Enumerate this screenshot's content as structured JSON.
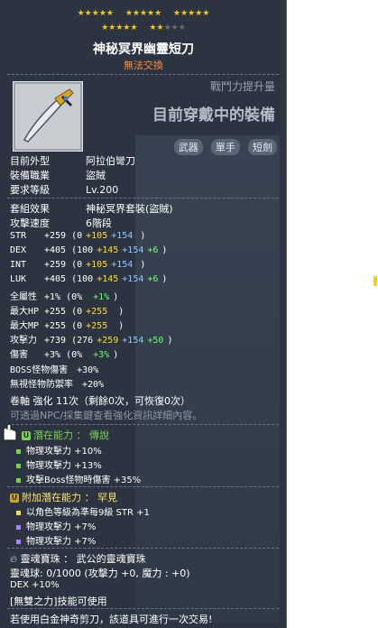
{
  "stars": {
    "row1": [
      "★★★★★",
      "★★★★★",
      "★★★★★"
    ],
    "row2_filled": [
      "★★★★★",
      "★★"
    ],
    "row2_empty": "★★★"
  },
  "item": {
    "name": "神秘冥界幽靈短刀",
    "trade": "無法交換",
    "power_up_label": "戰鬥力提升量",
    "wearing_label": "目前穿戴中的裝備"
  },
  "categories": [
    "武器",
    "單手",
    "短劍"
  ],
  "info": [
    {
      "label": "目前外型",
      "value": "阿拉伯彎刀"
    },
    {
      "label": "裝備職業",
      "value": "盜賊"
    },
    {
      "label": "要求等級",
      "value": "Lv.200"
    }
  ],
  "set": {
    "label": "套組效果",
    "value": "神秘冥界套裝(盜賊)"
  },
  "speed": {
    "label": "攻擊速度",
    "value": "6階段"
  },
  "stats": [
    {
      "name": "STR",
      "total": "+259",
      "open": "(0",
      "y": "+105",
      "b": "+154",
      "g": "",
      "close": ")"
    },
    {
      "name": "DEX",
      "total": "+405",
      "open": "(100",
      "y": "+145",
      "b": "+154",
      "g": "+6",
      "close": ")"
    },
    {
      "name": "INT",
      "total": "+259",
      "open": "(0",
      "y": "+105",
      "b": "+154",
      "g": "",
      "close": ")"
    },
    {
      "name": "LUK",
      "total": "+405",
      "open": "(100",
      "y": "+145",
      "b": "+154",
      "g": "+6",
      "close": ")"
    },
    {
      "name": "全屬性",
      "total": "+1%",
      "open": "(0%",
      "y": "",
      "b": "",
      "g": "+1%",
      "close": ")"
    },
    {
      "name": "最大HP",
      "total": "+255",
      "open": "(0",
      "y": "+255",
      "b": "",
      "g": "",
      "close": ")"
    },
    {
      "name": "最大MP",
      "total": "+255",
      "open": "(0",
      "y": "+255",
      "b": "",
      "g": "",
      "close": ")"
    },
    {
      "name": "攻擊力",
      "total": "+739",
      "open": "(276",
      "y": "+259",
      "b": "+154",
      "g": "+50",
      "close": ")"
    },
    {
      "name": "傷害",
      "total": "+3%",
      "open": "(0%",
      "y": "",
      "b": "",
      "g": "+3%",
      "close": ")"
    }
  ],
  "boss": "BOSS怪物傷害　+30%",
  "ignore": "無視怪物防禦率　+20%",
  "scroll": "卷軸 強化 11次（剩餘0次，可恢復0次）",
  "scroll_hint": "可透過NPC/採集鍵查看強化資訊詳細內容。",
  "potential": {
    "title": "潛在能力 ： 傳說",
    "lines": [
      "物理攻擊力 +10%",
      "物理攻擊力 +13%",
      "攻擊Boss怪物時傷害 +35%"
    ],
    "color": "#7bd24f"
  },
  "additional": {
    "title": "附加潛在能力 ： 罕見",
    "lines": [
      "以角色等級為準每9級 STR +1",
      "物理攻擊力 +7%",
      "物理攻擊力 +7%"
    ],
    "colors": [
      "#ffd84a",
      "#b07cff",
      "#b07cff"
    ]
  },
  "soul": {
    "title": "靈魂寶珠 ： 武公的靈魂寶珠",
    "info": "靈魂球: 0/1000 (攻擊力 +0, 魔力 : +0)",
    "dex": "DEX +10%",
    "skill": "[無雙之力]技能可使用"
  },
  "footer": "若使用白金神奇剪刀，該道具可進行一次交易!",
  "potential_badge": "U",
  "additional_badge": "U"
}
